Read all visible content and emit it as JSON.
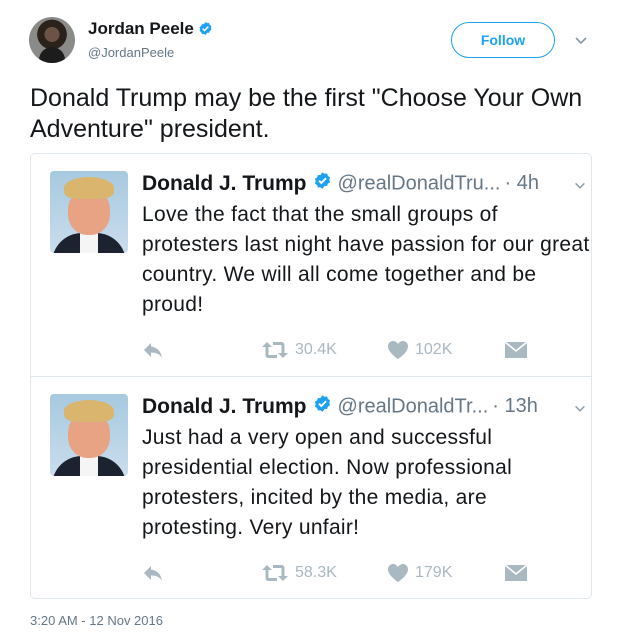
{
  "author": {
    "name": "Jordan Peele",
    "handle": "@JordanPeele",
    "follow_label": "Follow"
  },
  "tweet": {
    "text": "Donald Trump may be the first \"Choose Your Own Adventure\" president.",
    "timestamp": "3:20 AM - 12 Nov 2016"
  },
  "quoted": [
    {
      "name": "Donald J. Trump",
      "handle": "@realDonaldTru...",
      "time": "· 4h",
      "text": "Love the fact that the small groups of protesters last night have passion for our great country. We will all come together and be proud!",
      "retweets": "30.4K",
      "likes": "102K"
    },
    {
      "name": "Donald J. Trump",
      "handle": "@realDonaldTr...",
      "time": "· 13h",
      "text": "Just had a very open and successful presidential election. Now professional protesters, incited by the media, are protesting. Very unfair!",
      "retweets": "58.3K",
      "likes": "179K"
    }
  ],
  "colors": {
    "accent": "#1da1f2",
    "muted": "#657786",
    "icon": "#aab8c2",
    "border": "#e1e8ed"
  },
  "icons": [
    "verified-badge-icon",
    "chevron-down-icon",
    "reply-icon",
    "retweet-icon",
    "heart-icon",
    "envelope-icon"
  ]
}
